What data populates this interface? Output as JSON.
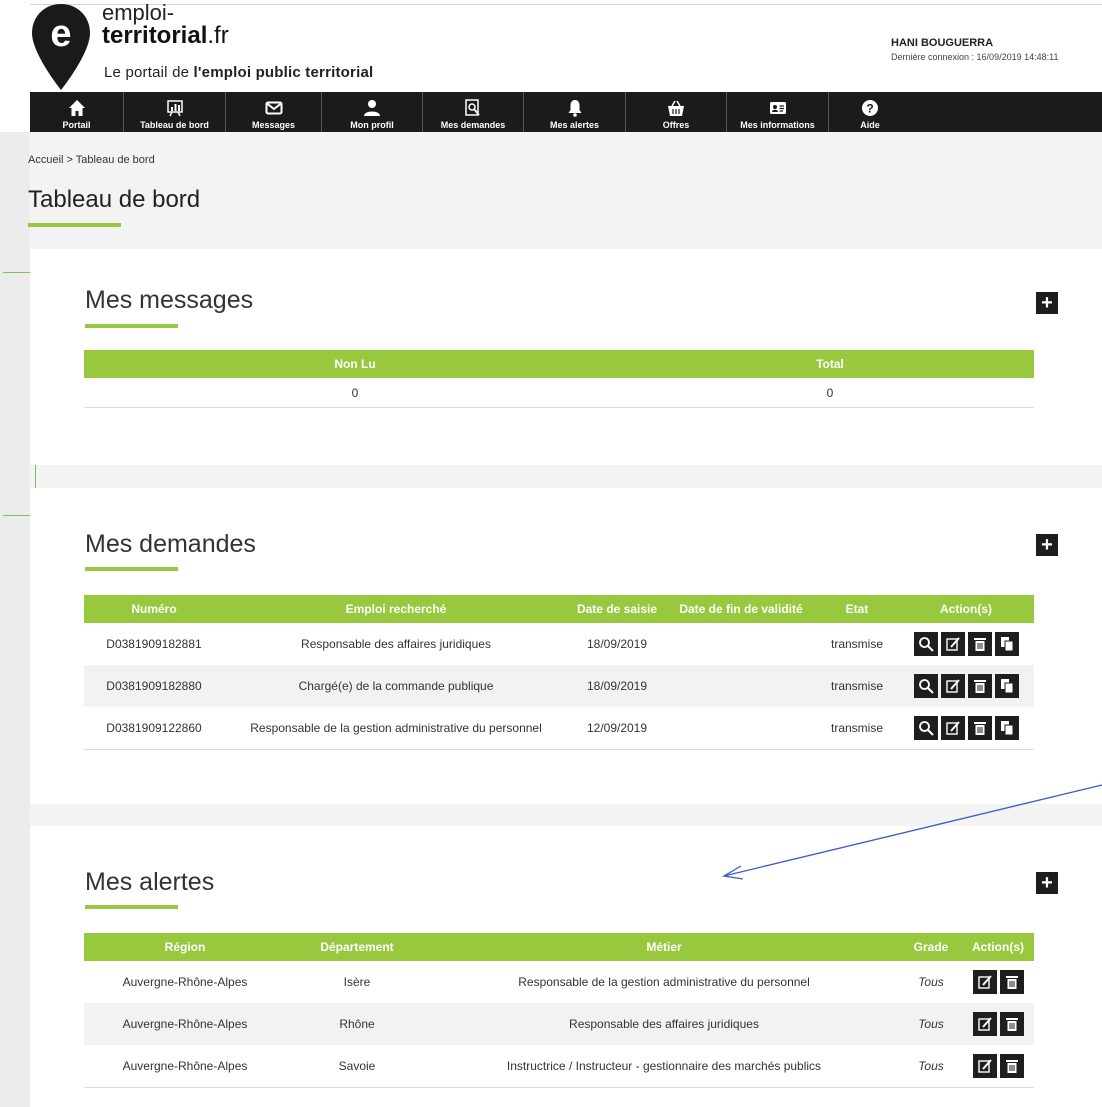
{
  "logo": {
    "line1": "emploi-",
    "line2_bold": "territorial",
    "line2_suffix": ".fr",
    "tagline_prefix": "Le portail de ",
    "tagline_bold": "l'emploi public territorial",
    "pin_letter": "e"
  },
  "user": {
    "name": "HANI BOUGUERRA",
    "last_login": "Dernière connexion : 16/09/2019 14:48:11"
  },
  "nav": [
    {
      "label": "Portail",
      "icon": "home-icon"
    },
    {
      "label": "Tableau de bord",
      "icon": "dashboard-icon"
    },
    {
      "label": "Messages",
      "icon": "envelope-icon"
    },
    {
      "label": "Mon profil",
      "icon": "user-icon"
    },
    {
      "label": "Mes demandes",
      "icon": "document-search-icon"
    },
    {
      "label": "Mes alertes",
      "icon": "bell-icon"
    },
    {
      "label": "Offres",
      "icon": "basket-icon"
    },
    {
      "label": "Mes informations",
      "icon": "id-card-icon"
    },
    {
      "label": "Aide",
      "icon": "help-icon"
    }
  ],
  "breadcrumb": "Accueil > Tableau de bord",
  "page_title": "Tableau de bord",
  "messages": {
    "title": "Mes messages",
    "headers": [
      "Non Lu",
      "Total"
    ],
    "row": [
      "0",
      "0"
    ]
  },
  "demandes": {
    "title": "Mes demandes",
    "headers": [
      "Numéro",
      "Emploi recherché",
      "Date de saisie",
      "Date de fin de validité",
      "Etat",
      "Action(s)"
    ],
    "rows": [
      [
        "D0381909182881",
        "Responsable des affaires juridiques",
        "18/09/2019",
        "",
        "transmise"
      ],
      [
        "D0381909182880",
        "Chargé(e) de la commande publique",
        "18/09/2019",
        "",
        "transmise"
      ],
      [
        "D0381909122860",
        "Responsable de la gestion administrative du personnel",
        "12/09/2019",
        "",
        "transmise"
      ]
    ]
  },
  "alertes": {
    "title": "Mes alertes",
    "headers": [
      "Région",
      "Département",
      "Métier",
      "Grade",
      "Action(s)"
    ],
    "rows": [
      [
        "Auvergne-Rhône-Alpes",
        "Isère",
        "Responsable de la gestion administrative du personnel",
        "Tous"
      ],
      [
        "Auvergne-Rhône-Alpes",
        "Rhône",
        "Responsable des affaires juridiques",
        "Tous"
      ],
      [
        "Auvergne-Rhône-Alpes",
        "Savoie",
        "Instructrice / Instructeur - gestionnaire des marchés publics",
        "Tous"
      ]
    ]
  },
  "colors": {
    "accent": "#97c83e",
    "navbar": "#1b1b1b",
    "annotation_arrow": "#3b5bc9"
  }
}
